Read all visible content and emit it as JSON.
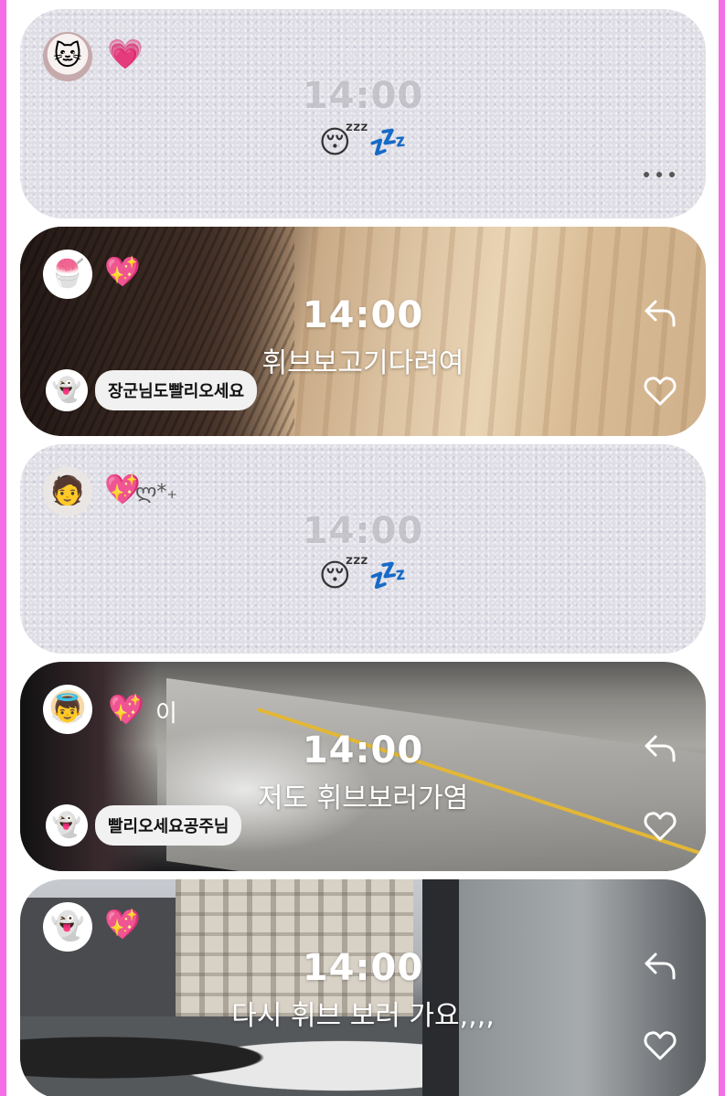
{
  "colors": {
    "frame": "#f46fe6",
    "card_gray": "#dedde5",
    "text_white": "#ffffff"
  },
  "posts": [
    {
      "type": "text",
      "avatar_icon": "hello-kitty-avatar",
      "avatar_glyph": "🐱",
      "sticker": "💗",
      "sticker_extra": "",
      "time": "14:00",
      "caption": "😴💤",
      "has_more": true,
      "mention": null
    },
    {
      "type": "photo",
      "avatar_icon": "shaved-ice-avatar",
      "avatar_glyph": "🍧",
      "sticker": "💖",
      "sticker_extra": "",
      "time": "14:00",
      "caption": "휘브보고기다려여",
      "mention": {
        "avatar_glyph": "👻",
        "name": "장군님도빨리오세요"
      }
    },
    {
      "type": "text",
      "avatar_icon": "man-avatar",
      "avatar_glyph": "🧑",
      "sticker": "💖",
      "sticker_extra": "ლ*₊",
      "time": "14:00",
      "caption": "😴💤",
      "has_more": false,
      "mention": null
    },
    {
      "type": "photo",
      "avatar_icon": "angel-baby-avatar",
      "avatar_glyph": "👼",
      "sticker": "💖",
      "sticker_extra": "이",
      "time": "14:00",
      "caption": "저도 휘브보러가염",
      "mention": {
        "avatar_glyph": "👻",
        "name": "빨리오세요공주님"
      }
    },
    {
      "type": "photo",
      "avatar_icon": "ghost-avatar",
      "avatar_glyph": "👻",
      "sticker": "💖",
      "sticker_extra": "",
      "time": "14:00",
      "caption": "다시 휘브 보러 가요,,,,",
      "mention": null
    }
  ]
}
